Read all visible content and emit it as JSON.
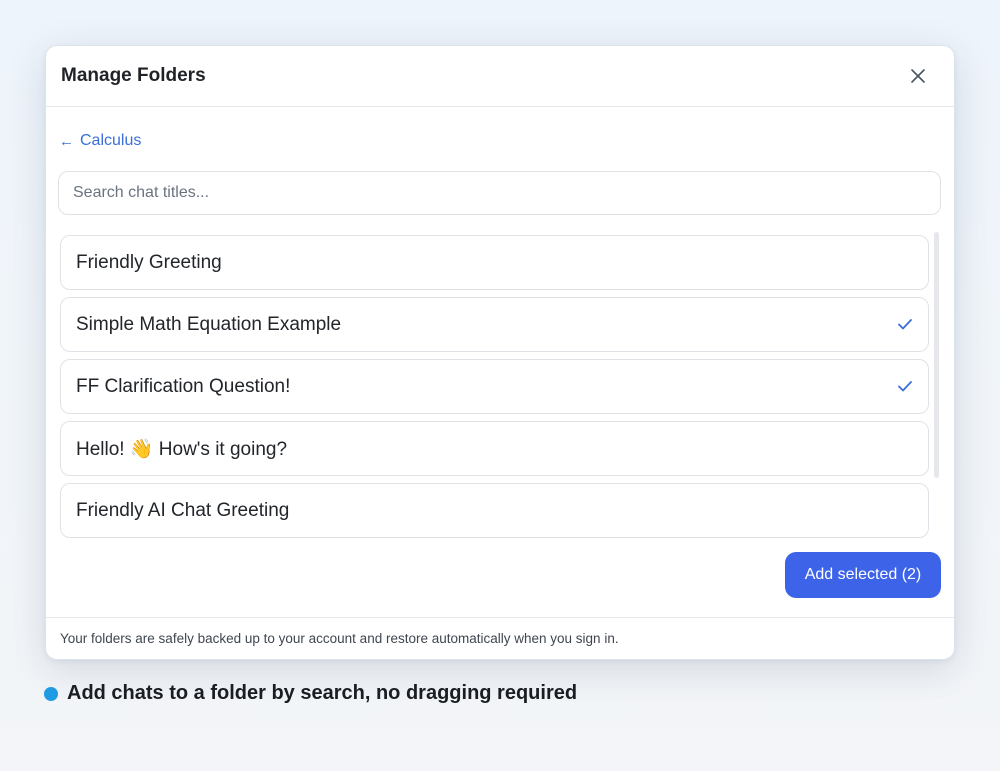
{
  "modal": {
    "title": "Manage Folders",
    "close_icon": "close-icon",
    "back_label": "Calculus",
    "back_icon": "arrow-left-icon",
    "search_placeholder": "Search chat titles...",
    "items": [
      {
        "label": "Friendly Greeting",
        "selected": false
      },
      {
        "label": "Simple Math Equation Example",
        "selected": true
      },
      {
        "label": "FF Clarification Question!",
        "selected": true
      },
      {
        "label": "Hello! 👋 How's it going?",
        "selected": false
      },
      {
        "label": "Friendly AI Chat Greeting",
        "selected": false
      }
    ],
    "add_button": "Add selected (2)",
    "footer": "Your folders are safely backed up to your account and restore automatically when you sign in."
  },
  "caption": {
    "text": "Add chats to a folder by search, no dragging required"
  },
  "colors": {
    "accent": "#3d63e8",
    "link": "#3b6fd8",
    "caption_dot": "#1e9be3"
  }
}
